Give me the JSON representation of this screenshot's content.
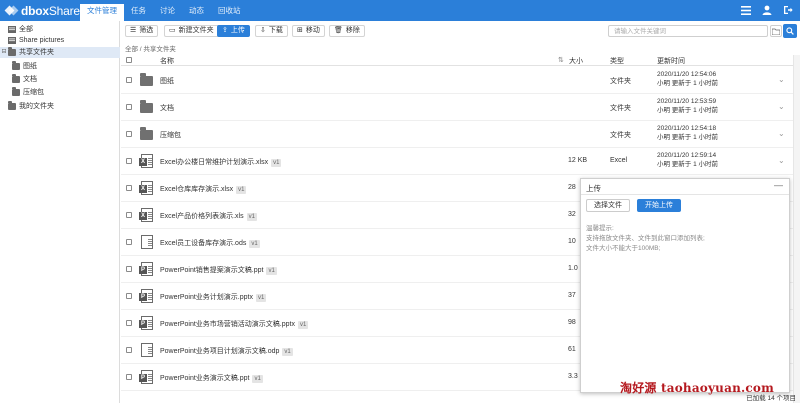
{
  "app": {
    "logo_main": "dbox",
    "logo_sub": "Share"
  },
  "topnav": [
    {
      "label": "文件管理"
    },
    {
      "label": "任务"
    },
    {
      "label": "讨论"
    },
    {
      "label": "动态"
    },
    {
      "label": "回收站"
    }
  ],
  "sidebar": {
    "items": [
      {
        "label": "全部"
      },
      {
        "label": "Share pictures"
      },
      {
        "label": "共享文件夹"
      },
      {
        "label": "图纸"
      },
      {
        "label": "文档"
      },
      {
        "label": "压缩包"
      },
      {
        "label": "我的文件夹"
      }
    ]
  },
  "toolbar": {
    "filter": "筛选",
    "new_folder": "新建文件夹",
    "upload": "上传",
    "download": "下载",
    "move": "移动",
    "remove": "移除",
    "search_placeholder": "请输入文件关键词"
  },
  "breadcrumb": "全部 / 共享文件夹",
  "table": {
    "headers": {
      "name": "名称",
      "size": "大小",
      "type": "类型",
      "updated": "更新时间"
    },
    "rows": [
      {
        "kind": "folder",
        "name": "图纸",
        "version": "",
        "size": "",
        "type": "文件夹",
        "time": "2020/11/20 12:54:06",
        "by": "小明 更新于 1 小时前"
      },
      {
        "kind": "folder",
        "name": "文档",
        "version": "",
        "size": "",
        "type": "文件夹",
        "time": "2020/11/20 12:53:59",
        "by": "小明 更新于 1 小时前"
      },
      {
        "kind": "folder",
        "name": "压缩包",
        "version": "",
        "size": "",
        "type": "文件夹",
        "time": "2020/11/20 12:54:18",
        "by": "小明 更新于 1 小时前"
      },
      {
        "kind": "excel",
        "name": "Excel办公楼日常维护计划演示.xlsx",
        "version": "v1",
        "size": "12 KB",
        "type": "Excel",
        "time": "2020/11/20 12:59:14",
        "by": "小明 更新于 1 小时前"
      },
      {
        "kind": "excel",
        "name": "Excel仓库库存演示.xlsx",
        "version": "v1",
        "size": "28",
        "type": "",
        "time": "",
        "by": ""
      },
      {
        "kind": "excel",
        "name": "Excel产品价格列表演示.xls",
        "version": "v1",
        "size": "32",
        "type": "",
        "time": "",
        "by": ""
      },
      {
        "kind": "doc",
        "name": "Excel员工设备库存演示.ods",
        "version": "v1",
        "size": "10",
        "type": "",
        "time": "",
        "by": ""
      },
      {
        "kind": "ppt",
        "name": "PowerPoint销售提案演示文稿.ppt",
        "version": "v1",
        "size": "1.0",
        "type": "",
        "time": "",
        "by": ""
      },
      {
        "kind": "ppt",
        "name": "PowerPoint业务计划演示.pptx",
        "version": "v1",
        "size": "37",
        "type": "",
        "time": "",
        "by": ""
      },
      {
        "kind": "ppt",
        "name": "PowerPoint业务市场营销活动演示文稿.pptx",
        "version": "v1",
        "size": "98",
        "type": "",
        "time": "",
        "by": ""
      },
      {
        "kind": "doc",
        "name": "PowerPoint业务项目计划演示文稿.odp",
        "version": "v1",
        "size": "61",
        "type": "",
        "time": "",
        "by": ""
      },
      {
        "kind": "ppt",
        "name": "PowerPoint业务演示文稿.ppt",
        "version": "v1",
        "size": "3.3",
        "type": "",
        "time": "",
        "by": ""
      }
    ]
  },
  "upload_panel": {
    "title": "上传",
    "choose_label": "选择文件",
    "start_label": "开始上传",
    "hint_title": "温馨提示:",
    "hint_1": "支持拖放文件夹、文件到此窗口添加列表;",
    "hint_2": "文件大小不能大于100MB;"
  },
  "footer": {
    "count": "已加载 14 个项目"
  },
  "watermark": "淘好源 taohaoyuan.com",
  "colors": {
    "accent": "#2b7fd9",
    "watermark": "#b5191f"
  }
}
